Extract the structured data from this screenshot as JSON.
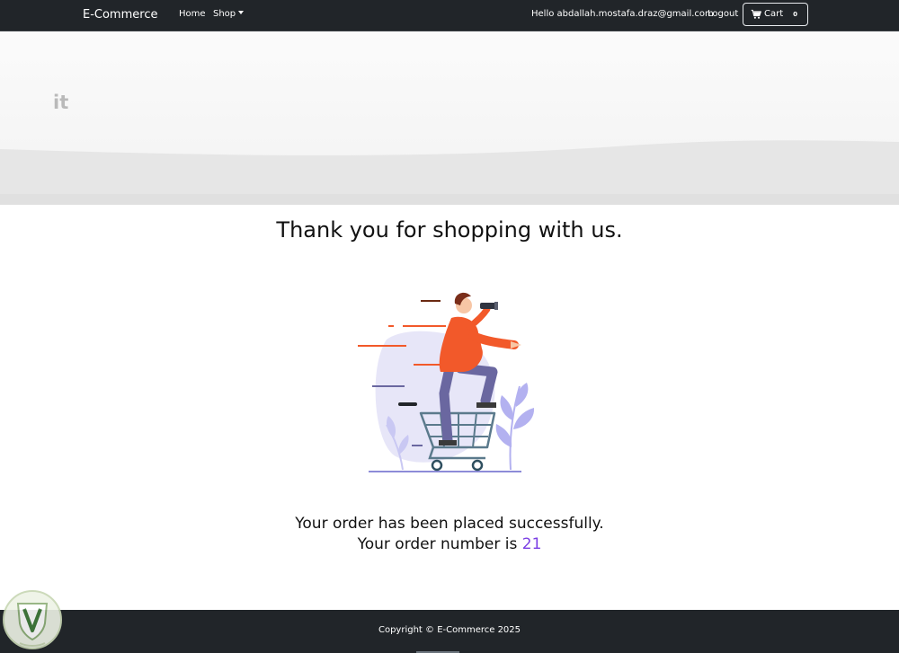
{
  "navbar": {
    "brand": "E-Commerce",
    "home": "Home",
    "shop": "Shop",
    "greeting": "Hello abdallah.mostafa.draz@gmail.com",
    "logout": "Logout",
    "cart_label": "Cart",
    "cart_count": "0"
  },
  "hero": {
    "text": "it"
  },
  "main": {
    "thanks": "Thank you for shopping with us.",
    "message": "Your order has been placed successfully.",
    "order_prefix": "Your order number is",
    "order_number": "21"
  },
  "footer": {
    "copyright": "Copyright © E-Commerce 2025"
  },
  "colors": {
    "navbar_bg": "#212529",
    "accent": "#7b3fe4",
    "shirt": "#f2592a",
    "pants": "#6a67a0",
    "plant": "#b3b1f0"
  },
  "icons": [
    "cart-icon",
    "caret-down-icon",
    "shopping-cart-illustration",
    "watermark-logo"
  ]
}
